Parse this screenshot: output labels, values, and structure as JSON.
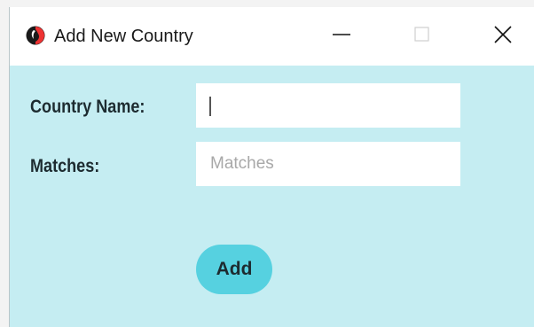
{
  "window": {
    "title": "Add New Country",
    "app_icon": "app-logo-icon",
    "controls": [
      "minimize-icon",
      "maximize-icon",
      "close-icon"
    ]
  },
  "form": {
    "country_label": "Country Name:",
    "country_value": "",
    "country_placeholder": "",
    "matches_label": "Matches:",
    "matches_value": "",
    "matches_placeholder": "Matches",
    "add_label": "Add"
  },
  "colors": {
    "background": "#c5edf2",
    "button": "#56d1e0",
    "titlebar": "#ffffff"
  }
}
